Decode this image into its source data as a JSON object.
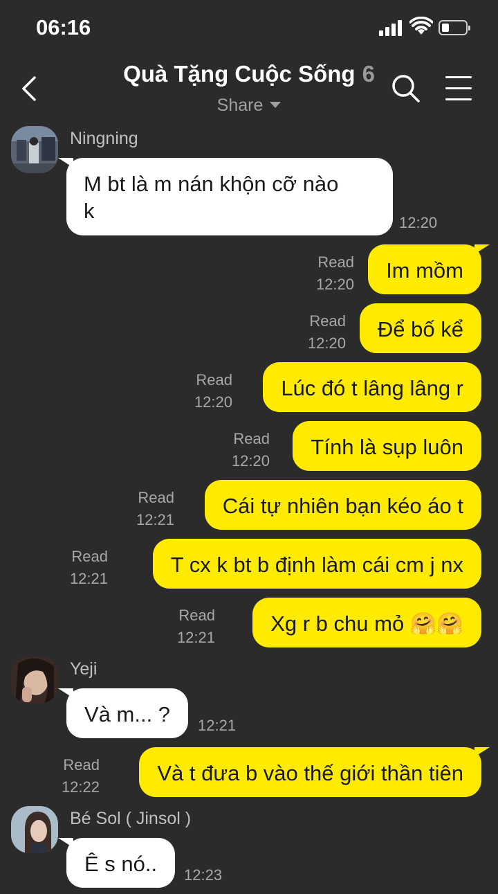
{
  "status_bar": {
    "time": "06:16"
  },
  "header": {
    "title": "Quà Tặng Cuộc Sống",
    "member_count": "6",
    "share_label": "Share"
  },
  "messages": [
    {
      "sender": "Ningning",
      "text": "M bt là m nán khộn cỡ nào",
      "text2": "k",
      "time": "12:20"
    },
    {
      "text": "Im mồm",
      "read": "Read",
      "time": "12:20"
    },
    {
      "text": "Để bố kể",
      "read": "Read",
      "time": "12:20"
    },
    {
      "text": "Lúc đó t lâng lâng r",
      "read": "Read",
      "time": "12:20"
    },
    {
      "text": "Tính là sụp luôn",
      "read": "Read",
      "time": "12:20"
    },
    {
      "text": "Cái tự nhiên bạn kéo áo t",
      "read": "Read",
      "time": "12:21"
    },
    {
      "text": "T cx k bt b định làm cái cm j nx",
      "read": "Read",
      "time": "12:21"
    },
    {
      "text": "Xg r b chu mỏ 🤗🤗",
      "read": "Read",
      "time": "12:21"
    },
    {
      "sender": "Yeji",
      "text": "Và m... ?",
      "time": "12:21"
    },
    {
      "text": "Và t đưa b vào thế giới thần tiên",
      "read": "Read",
      "time": "12:22"
    },
    {
      "sender": "Bé Sol ( Jinsol )",
      "text": "Ê s nó..",
      "time": "12:23"
    }
  ],
  "colors": {
    "background": "#2b2b2b",
    "outgoing_bubble": "#ffeb00",
    "incoming_bubble": "#ffffff"
  }
}
